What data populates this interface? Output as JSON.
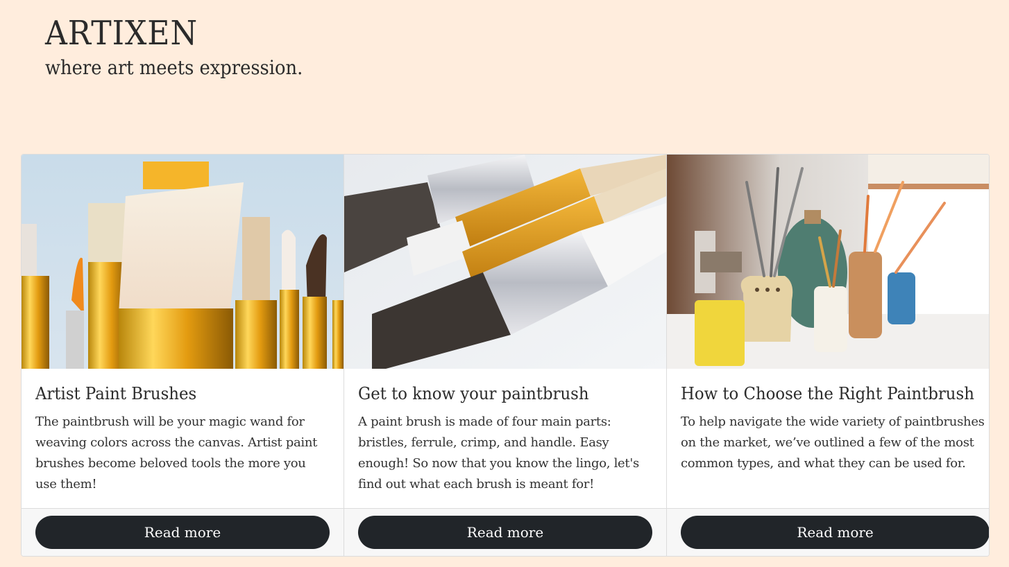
{
  "header": {
    "brand": "ARTIXEN",
    "tagline": "where art meets expression."
  },
  "cards": [
    {
      "image_alt": "paint brushes with golden ferrules on light blue background",
      "title": "Artist Paint Brushes",
      "text": "The paintbrush will be your magic wand for weaving colors across the canvas. Artist paint brushes become beloved tools the more you use them!",
      "button": "Read more"
    },
    {
      "image_alt": "flat paint brushes lying diagonally on white surface",
      "title": "Get to know your paintbrush",
      "text": "A paint brush is made of four main parts: bristles, ferrule, crimp, and handle. Easy enough! So now that you know the lingo, let's find out what each brush is meant for!",
      "button": "Read more"
    },
    {
      "image_alt": "jars of paintbrushes on a windowsill",
      "title": "How to Choose the Right Paintbrush",
      "text": "To help navigate the wide variety of paintbrushes on the market, we’ve outlined a few of the most common types, and what they can be used for.",
      "button": "Read more"
    }
  ],
  "colors": {
    "background": "#ffeddd",
    "button": "#212529",
    "footer": "#f7f7f7"
  }
}
